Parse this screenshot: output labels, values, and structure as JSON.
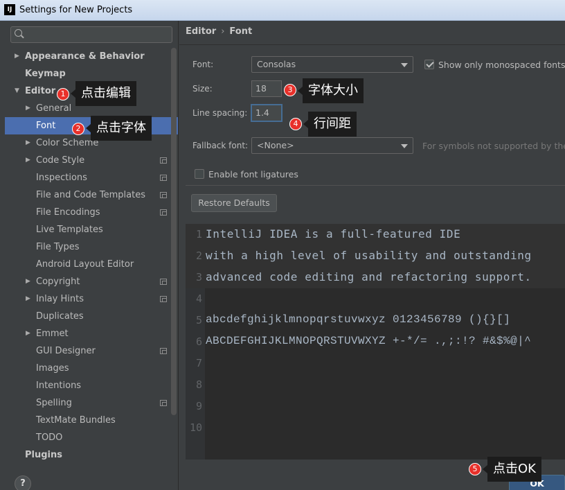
{
  "window": {
    "icon_text": "IJ",
    "title": "Settings for New Projects"
  },
  "sidebar": {
    "search_placeholder": "",
    "items": [
      {
        "label": "Appearance & Behavior",
        "level": 0,
        "arrow": "right",
        "bold": true
      },
      {
        "label": "Keymap",
        "level": 0,
        "bold": true
      },
      {
        "label": "Editor",
        "level": 0,
        "arrow": "down",
        "bold": true
      },
      {
        "label": "General",
        "level": 1,
        "arrow": "right"
      },
      {
        "label": "Font",
        "level": 1,
        "selected": true
      },
      {
        "label": "Color Scheme",
        "level": 1,
        "arrow": "right"
      },
      {
        "label": "Code Style",
        "level": 1,
        "arrow": "right",
        "project_icon": true
      },
      {
        "label": "Inspections",
        "level": 1,
        "project_icon": true
      },
      {
        "label": "File and Code Templates",
        "level": 1,
        "project_icon": true
      },
      {
        "label": "File Encodings",
        "level": 1,
        "project_icon": true
      },
      {
        "label": "Live Templates",
        "level": 1
      },
      {
        "label": "File Types",
        "level": 1
      },
      {
        "label": "Android Layout Editor",
        "level": 1
      },
      {
        "label": "Copyright",
        "level": 1,
        "arrow": "right",
        "project_icon": true
      },
      {
        "label": "Inlay Hints",
        "level": 1,
        "arrow": "right",
        "project_icon": true
      },
      {
        "label": "Duplicates",
        "level": 1
      },
      {
        "label": "Emmet",
        "level": 1,
        "arrow": "right"
      },
      {
        "label": "GUI Designer",
        "level": 1,
        "project_icon": true
      },
      {
        "label": "Images",
        "level": 1
      },
      {
        "label": "Intentions",
        "level": 1
      },
      {
        "label": "Spelling",
        "level": 1,
        "project_icon": true
      },
      {
        "label": "TextMate Bundles",
        "level": 1
      },
      {
        "label": "TODO",
        "level": 1
      },
      {
        "label": "Plugins",
        "level": 0,
        "bold": true
      }
    ],
    "help_label": "?"
  },
  "main": {
    "breadcrumb": {
      "parent": "Editor",
      "separator": "›",
      "current": "Font"
    },
    "font_label": "Font:",
    "font_value": "Consolas",
    "show_monospaced_label": "Show only monospaced fonts",
    "show_monospaced_checked": true,
    "size_label": "Size:",
    "size_value": "18",
    "line_spacing_label": "Line spacing:",
    "line_spacing_value": "1.4",
    "fallback_label": "Fallback font:",
    "fallback_value": "<None>",
    "fallback_hint": "For symbols not supported by the m",
    "ligatures_label": "Enable font ligatures",
    "ligatures_checked": false,
    "restore_button": "Restore Defaults"
  },
  "preview": {
    "lines": [
      {
        "no": "1",
        "text": "IntelliJ IDEA is a full-featured IDE"
      },
      {
        "no": "2",
        "text": "with a high level of usability and outstanding"
      },
      {
        "no": "3",
        "text": "advanced code editing and refactoring support."
      },
      {
        "no": "4",
        "text": ""
      },
      {
        "no": "5",
        "text": "abcdefghijklmnopqrstuvwxyz 0123456789 (){}[]"
      },
      {
        "no": "6",
        "text": "ABCDEFGHIJKLMNOPQRSTUVWXYZ +-*/= .,;:!? #&$%@|^"
      },
      {
        "no": "7",
        "text": ""
      },
      {
        "no": "8",
        "text": ""
      },
      {
        "no": "9",
        "text": ""
      },
      {
        "no": "10",
        "text": ""
      }
    ]
  },
  "annotations": [
    {
      "num": "1",
      "text": "点击编辑"
    },
    {
      "num": "2",
      "text": "点击字体"
    },
    {
      "num": "3",
      "text": "字体大小"
    },
    {
      "num": "4",
      "text": "行间距"
    },
    {
      "num": "5",
      "text": "点击OK"
    }
  ],
  "footer": {
    "ok_label": "OK"
  },
  "colors": {
    "selection": "#4b6eaf",
    "badge": "#e8302a",
    "tag_bg": "#1c1c1c",
    "editor_bg": "#2b2b2b",
    "panel_bg": "#3c3f41"
  }
}
